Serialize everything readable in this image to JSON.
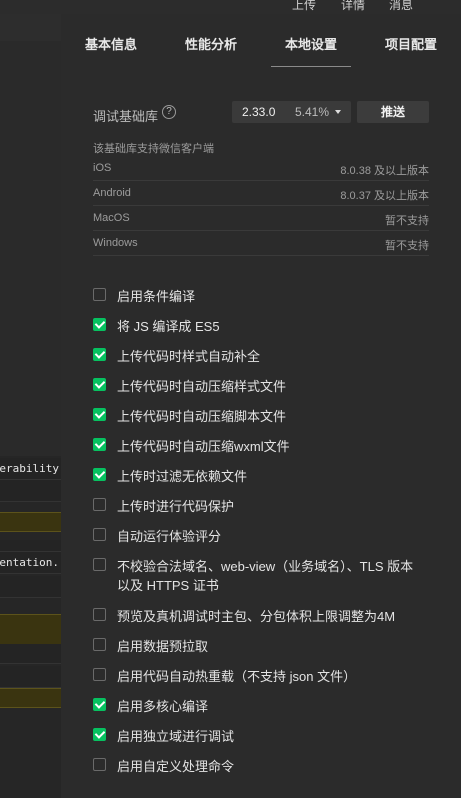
{
  "topbar": {
    "items": [
      "上传",
      "详情",
      "消息"
    ]
  },
  "background_console": {
    "rows": [
      {
        "text": "erability",
        "warn": false
      },
      {
        "text": "",
        "warn": false
      },
      {
        "text": "",
        "warn": true
      },
      {
        "text": "",
        "warn": false
      },
      {
        "text": "mentation.",
        "warn": false
      },
      {
        "text": "",
        "warn": false
      },
      {
        "text": "",
        "warn": true
      },
      {
        "text": "",
        "warn": false
      },
      {
        "text": "",
        "warn": false
      },
      {
        "text": "",
        "warn": true
      }
    ]
  },
  "tabs": [
    {
      "label": "基本信息",
      "active": false
    },
    {
      "label": "性能分析",
      "active": false
    },
    {
      "label": "本地设置",
      "active": true
    },
    {
      "label": "项目配置",
      "active": false
    }
  ],
  "debug_lib": {
    "label": "调试基础库",
    "help_icon": "help-circle-icon",
    "version": "2.33.0",
    "percent": "5.41%",
    "push_label": "推送"
  },
  "support": {
    "title": "该基础库支持微信客户端",
    "rows": [
      {
        "os": "iOS",
        "version": "8.0.38 及以上版本"
      },
      {
        "os": "Android",
        "version": "8.0.37 及以上版本"
      },
      {
        "os": "MacOS",
        "version": "暂不支持"
      },
      {
        "os": "Windows",
        "version": "暂不支持"
      }
    ]
  },
  "options": [
    {
      "label": "启用条件编译",
      "checked": false
    },
    {
      "label": "将 JS 编译成 ES5",
      "checked": true
    },
    {
      "label": "上传代码时样式自动补全",
      "checked": true
    },
    {
      "label": "上传代码时自动压缩样式文件",
      "checked": true
    },
    {
      "label": "上传代码时自动压缩脚本文件",
      "checked": true
    },
    {
      "label": "上传代码时自动压缩wxml文件",
      "checked": true
    },
    {
      "label": "上传时过滤无依赖文件",
      "checked": true
    },
    {
      "label": "上传时进行代码保护",
      "checked": false
    },
    {
      "label": "自动运行体验评分",
      "checked": false
    },
    {
      "label": "不校验合法域名、web-view（业务域名）、TLS 版本以及 HTTPS 证书",
      "checked": false
    },
    {
      "label": "预览及真机调试时主包、分包体积上限调整为4M",
      "checked": false
    },
    {
      "label": "启用数据预拉取",
      "checked": false
    },
    {
      "label": "启用代码自动热重载（不支持 json 文件）",
      "checked": false
    },
    {
      "label": "启用多核心编译",
      "checked": true
    },
    {
      "label": "启用独立域进行调试",
      "checked": true
    },
    {
      "label": "启用自定义处理命令",
      "checked": false
    }
  ],
  "colors": {
    "checkbox_on": "#07c160",
    "panel_bg": "#2b2b2b"
  }
}
